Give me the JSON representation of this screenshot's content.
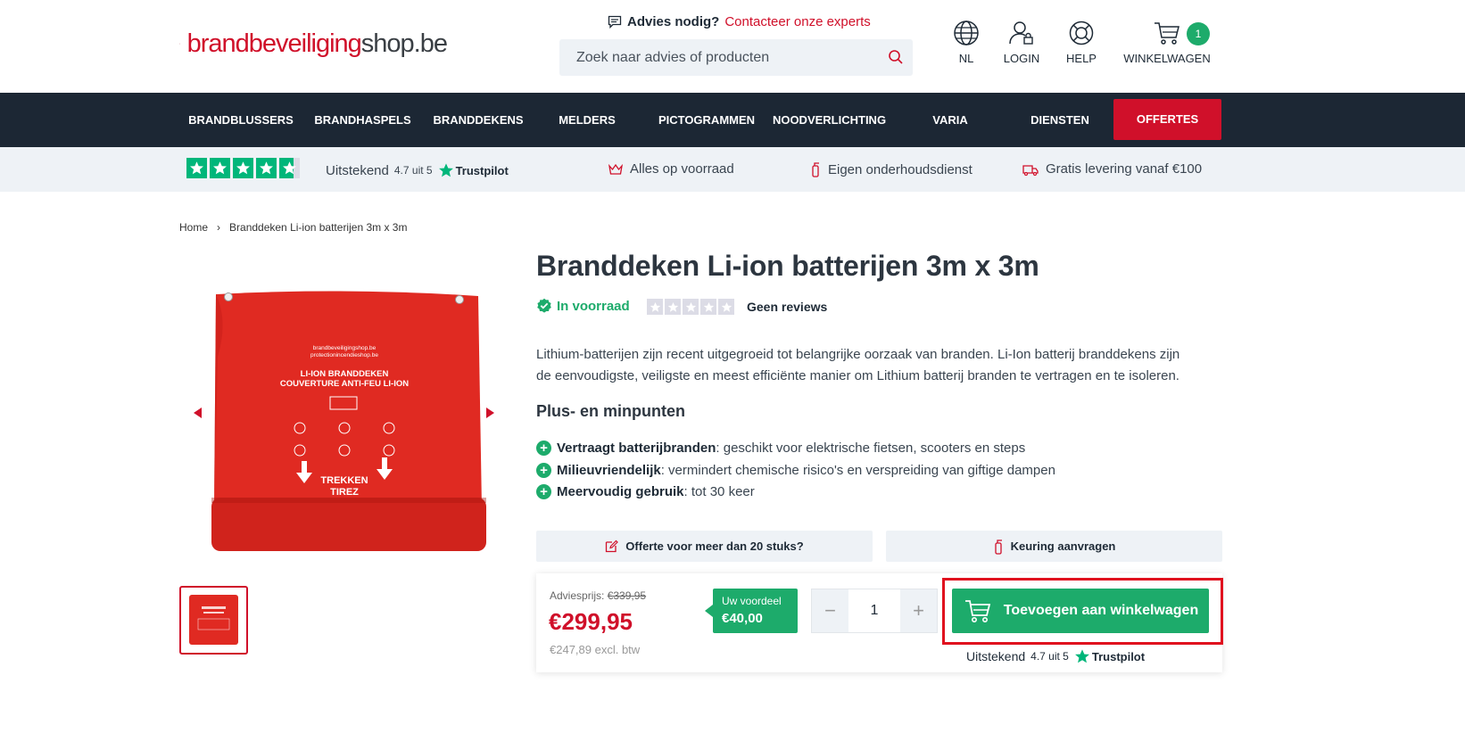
{
  "header": {
    "logo_text_a": "brandbeveiliging",
    "logo_text_b": "shop.be",
    "advies_label": "Advies nodig?",
    "advies_link": "Contacteer onze experts",
    "search_placeholder": "Zoek naar advies of producten",
    "language_label": "NL",
    "login_label": "LOGIN",
    "help_label": "HELP",
    "cart_label": "WINKELWAGEN",
    "cart_count": "1"
  },
  "nav": {
    "items": [
      "BRANDBLUSSERS",
      "BRANDHASPELS",
      "BRANDDEKENS",
      "MELDERS",
      "PICTOGRAMMEN",
      "NOODVERLICHTING",
      "VARIA",
      "DIENSTEN"
    ],
    "offertes": "OFFERTES"
  },
  "usp": {
    "rating_label": "Uitstekend",
    "rating_value": "4.7 uit 5",
    "trustpilot": "Trustpilot",
    "items": [
      "Alles op voorraad",
      "Eigen onderhoudsdienst",
      "Gratis levering vanaf €100"
    ]
  },
  "breadcrumb": {
    "home": "Home",
    "separator": "›",
    "current": "Branddeken Li-ion batterijen 3m x 3m"
  },
  "product": {
    "title": "Branddeken Li-ion batterijen 3m x 3m",
    "stock": "In voorraad",
    "reviews": "Geen reviews",
    "description": "Lithium-batterijen zijn recent uitgegroeid tot belangrijke oorzaak van branden. Li-Ion batterij branddekens zijn de eenvoudigste, veiligste en meest efficiënte manier om Lithium batterij branden te vertragen en te isoleren.",
    "pros_title": "Plus- en minpunten",
    "pros": [
      {
        "bold": "Vertraagt batterijbranden",
        "text": ": geschikt voor elektrische fietsen, scooters en steps"
      },
      {
        "bold": "Milieuvriendelijk",
        "text": ": vermindert chemische risico's en verspreiding van giftige dampen"
      },
      {
        "bold": "Meervoudig gebruik",
        "text": ": tot 30 keer"
      }
    ],
    "offerte_button": "Offerte voor meer dan 20 stuks?",
    "keuring_button": "Keuring aanvragen",
    "image_text": {
      "brand1": "brandbeveiligingshop.be",
      "brand2": "protectionincendieshop.be",
      "line1": "LI-ION BRANDDEKEN",
      "line2": "COUVERTURE ANTI-FEU LI-ION",
      "pull1": "TREKKEN",
      "pull2": "TIREZ"
    }
  },
  "buybox": {
    "advies_prijs_label": "Adviesprijs:",
    "advies_prijs": "€339,95",
    "price": "€299,95",
    "price_excl": "€247,89 excl. btw",
    "voordeel_label": "Uw voordeel",
    "voordeel_value": "€40,00",
    "qty_minus": "−",
    "qty_value": "1",
    "qty_plus": "+",
    "add_to_cart": "Toevoegen aan winkelwagen",
    "rating_label": "Uitstekend",
    "rating_value": "4.7 uit 5",
    "trustpilot": "Trustpilot"
  },
  "colors": {
    "brand_red": "#d0102a",
    "accent_green": "#1dab6b",
    "nav_bg": "#1c2734",
    "light_bg": "#eef2f6",
    "trustpilot_green": "#00b67a"
  }
}
